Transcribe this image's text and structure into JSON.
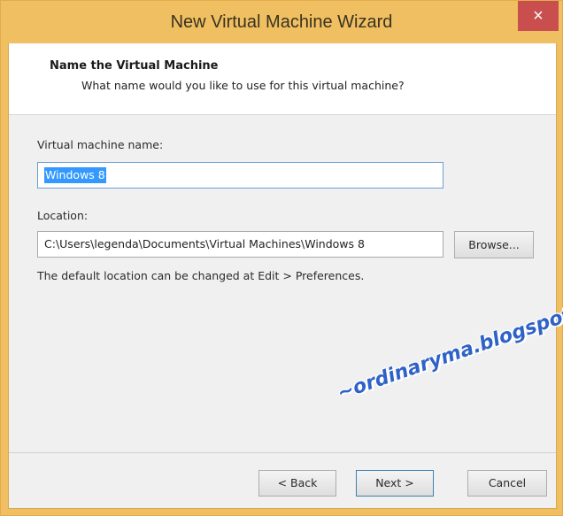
{
  "window": {
    "title": "New Virtual Machine Wizard",
    "close_glyph": "×"
  },
  "header": {
    "title": "Name the Virtual Machine",
    "subtitle": "What name would you like to use for this virtual machine?"
  },
  "form": {
    "vm_name_label": "Virtual machine name:",
    "vm_name_value": "Windows 8",
    "location_label": "Location:",
    "location_value": "C:\\Users\\legenda\\Documents\\Virtual Machines\\Windows 8",
    "browse_label": "Browse...",
    "hint": "The default location can be changed at Edit > Preferences."
  },
  "footer": {
    "back_label": "< Back",
    "next_label": "Next >",
    "cancel_label": "Cancel"
  },
  "watermark": "~ordinaryma.blogspot.com~",
  "colors": {
    "titlebar": "#efbf62",
    "close_button": "#c94f4f",
    "selection": "#3399ff",
    "watermark": "#2f62c8"
  }
}
